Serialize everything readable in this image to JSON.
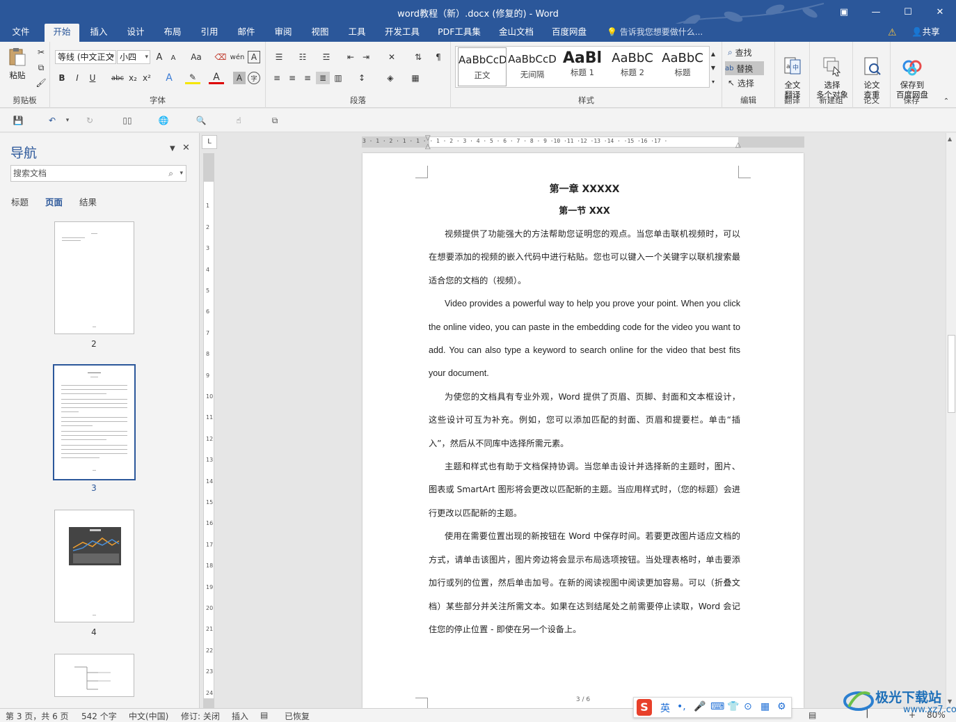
{
  "window": {
    "title": "word教程（新）.docx (修复的) - Word",
    "restore_label": "▣",
    "minimize_label": "—",
    "maximize_label": "☐",
    "close_label": "✕"
  },
  "tabs": {
    "items": [
      {
        "label": "文件"
      },
      {
        "label": "开始"
      },
      {
        "label": "插入"
      },
      {
        "label": "设计"
      },
      {
        "label": "布局"
      },
      {
        "label": "引用"
      },
      {
        "label": "邮件"
      },
      {
        "label": "审阅"
      },
      {
        "label": "视图"
      },
      {
        "label": "工具"
      },
      {
        "label": "开发工具"
      },
      {
        "label": "PDF工具集"
      },
      {
        "label": "金山文档"
      },
      {
        "label": "百度网盘"
      }
    ],
    "active": "开始",
    "tell_me": "告诉我您想要做什么...",
    "share": "共享"
  },
  "ribbon": {
    "clipboard": {
      "label": "剪贴板",
      "paste": "粘贴"
    },
    "font": {
      "label": "字体",
      "font_name": "等线 (中文正文",
      "font_size": "小四",
      "grow": "A",
      "shrink": "A",
      "case": "Aa",
      "bold": "B",
      "italic": "I",
      "underline": "U",
      "strike": "abc",
      "subscript": "x₂",
      "superscript": "x²",
      "phonetic": "wén",
      "border_char": "A",
      "shading_char": "A",
      "enclose_char": "字"
    },
    "paragraph": {
      "label": "段落"
    },
    "styles": {
      "label": "样式",
      "items": [
        {
          "preview": "AaBbCcDd",
          "name": "正文"
        },
        {
          "preview": "AaBbCcD",
          "name": "无间隔"
        },
        {
          "preview": "AaBl",
          "name": "标题 1"
        },
        {
          "preview": "AaBbC",
          "name": "标题 2"
        },
        {
          "preview": "AaBbC",
          "name": "标题"
        }
      ]
    },
    "editing": {
      "label": "编辑",
      "find": "查找",
      "replace": "替换",
      "select": "选择"
    },
    "translate": {
      "label": "翻译",
      "full": "全文\n翻译"
    },
    "newgroup": {
      "label": "新建组",
      "select_multi": "选择\n多个对象"
    },
    "paper": {
      "label": "论文",
      "check": "论文\n查重"
    },
    "save": {
      "label": "保存",
      "save_baidu": "保存到\n百度网盘"
    }
  },
  "nav": {
    "title": "导航",
    "search_placeholder": "搜索文档",
    "tabs": [
      {
        "label": "标题"
      },
      {
        "label": "页面"
      },
      {
        "label": "结果"
      }
    ],
    "active_tab": "页面",
    "thumbs": [
      {
        "num": "2"
      },
      {
        "num": "3"
      },
      {
        "num": "4"
      }
    ],
    "selected_page": "3"
  },
  "ruler": {
    "h_numbers": "3 · 1 · 2 · 1 · 1 ·       · 1 · 2 · 3 · 4 · 5 · 6 · 7 · 8 · 9 ·10 ·11 ·12 ·13 ·14 ·  ·15 ·16 ·17 ·",
    "corner": "L"
  },
  "document": {
    "chapter": "第一章  XXXXX",
    "section": "第一节  XXX",
    "paragraphs": [
      "视频提供了功能强大的方法帮助您证明您的观点。当您单击联机视频时，可以在想要添加的视频的嵌入代码中进行粘贴。您也可以键入一个关键字以联机搜索最适合您的文档的（视频）。",
      "Video provides a powerful way to help you prove your point. When you click the online video, you can paste in the embedding code for the video you want to add. You can also type a keyword to search online for the video that best fits your document.",
      "为使您的文档具有专业外观，Word 提供了页眉、页脚、封面和文本框设计，这些设计可互为补充。例如，您可以添加匹配的封面、页眉和提要栏。单击“插入”，然后从不同库中选择所需元素。",
      "主题和样式也有助于文档保持协调。当您单击设计并选择新的主题时，图片、图表或 SmartArt 图形将会更改以匹配新的主题。当应用样式时，（您的标题）会进行更改以匹配新的主题。",
      "使用在需要位置出现的新按钮在 Word 中保存时间。若要更改图片适应文档的方式，请单击该图片，图片旁边将会显示布局选项按钮。当处理表格时，单击要添加行或列的位置，然后单击加号。在新的阅读视图中阅读更加容易。可以（折叠文档）某些部分并关注所需文本。如果在达到结尾处之前需要停止读取，Word 会记住您的停止位置 - 即使在另一个设备上。"
    ],
    "page_number": "3 / 6"
  },
  "status": {
    "page": "第 3 页，共 6 页",
    "words": "542 个字",
    "language": "中文(中国)",
    "track": "修订: 关闭",
    "mode": "插入",
    "recovered": "已恢复",
    "zoom": "80%"
  },
  "ime": {
    "lang": "英"
  },
  "watermark": {
    "text": "极光下载站",
    "url": "www.xz7.com"
  },
  "colors": {
    "accent": "#2b579a",
    "ribbon_bg": "#f3f3f3",
    "page_bg": "#ffffff"
  }
}
